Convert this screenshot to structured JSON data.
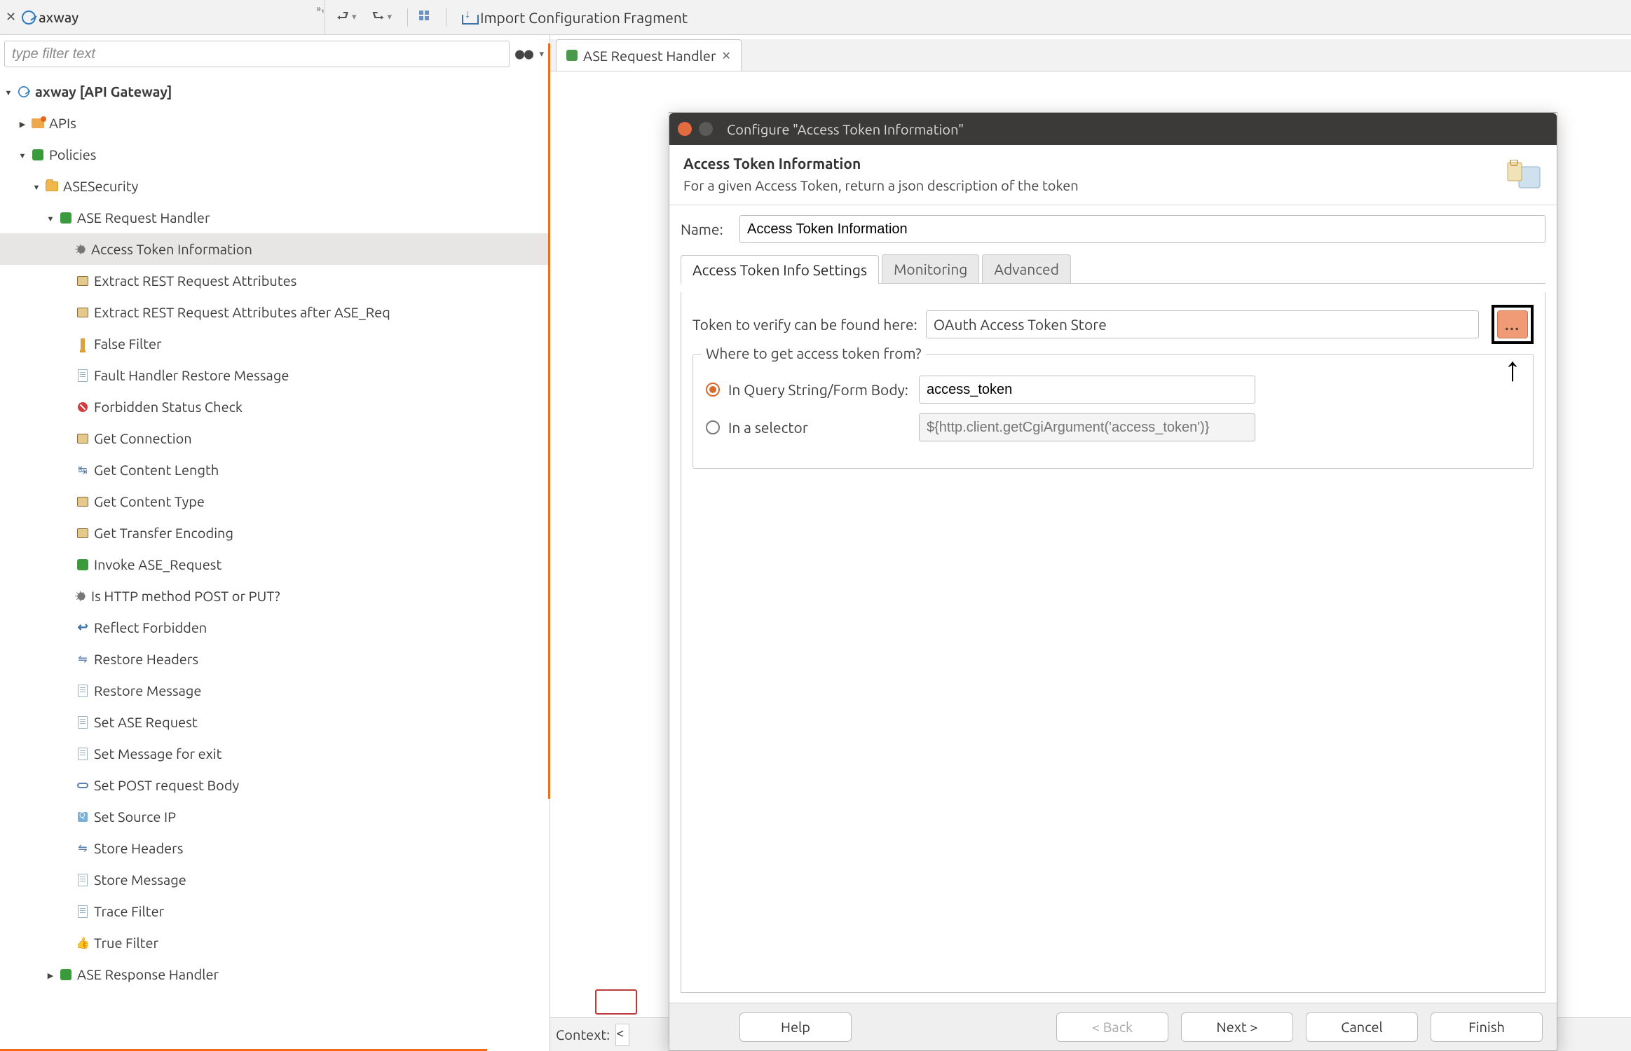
{
  "toolbar": {
    "brand": "axway",
    "superscript": "»₁",
    "import_label": "Import Configuration Fragment"
  },
  "filter": {
    "placeholder": "type filter text"
  },
  "tree": {
    "root": {
      "label": "axway [API Gateway]"
    },
    "apis": {
      "label": "APIs"
    },
    "policies": {
      "label": "Policies"
    },
    "asesecurity": {
      "label": "ASESecurity"
    },
    "request_handler": {
      "label": "ASE Request Handler"
    },
    "items": [
      "Access Token Information",
      "Extract REST Request Attributes",
      "Extract REST Request Attributes after ASE_Req",
      "False Filter",
      "Fault Handler Restore Message",
      "Forbidden Status Check",
      "Get Connection",
      "Get Content Length",
      "Get Content Type",
      "Get Transfer Encoding",
      "Invoke ASE_Request",
      "Is HTTP method POST or PUT?",
      "Reflect Forbidden",
      "Restore Headers",
      "Restore Message",
      "Set ASE Request",
      "Set Message for exit",
      "Set POST request Body",
      "Set Source IP",
      "Store Headers",
      "Store Message",
      "Trace Filter",
      "True Filter"
    ],
    "response_handler": {
      "label": "ASE Response Handler"
    }
  },
  "editor": {
    "tab_label": "ASE Request Handler",
    "context_label": "Context:",
    "context_value": "<"
  },
  "dialog": {
    "title": "Configure \"Access Token Information\"",
    "heading": "Access Token Information",
    "description": "For a given Access Token, return a json description of the token",
    "name_label": "Name:",
    "name_value": "Access Token Information",
    "tabs": {
      "settings": "Access Token Info Settings",
      "monitoring": "Monitoring",
      "advanced": "Advanced"
    },
    "verify_label": "Token to verify can be found here:",
    "verify_value": "OAuth Access Token Store",
    "browse_label": "...",
    "fieldset_legend": "Where to get access token from?",
    "radio1_label": "In Query String/Form Body:",
    "radio1_value": "access_token",
    "radio2_label": "In a selector",
    "radio2_placeholder": "${http.client.getCgiArgument('access_token')}",
    "buttons": {
      "help": "Help",
      "back": "< Back",
      "next": "Next >",
      "cancel": "Cancel",
      "finish": "Finish"
    }
  }
}
